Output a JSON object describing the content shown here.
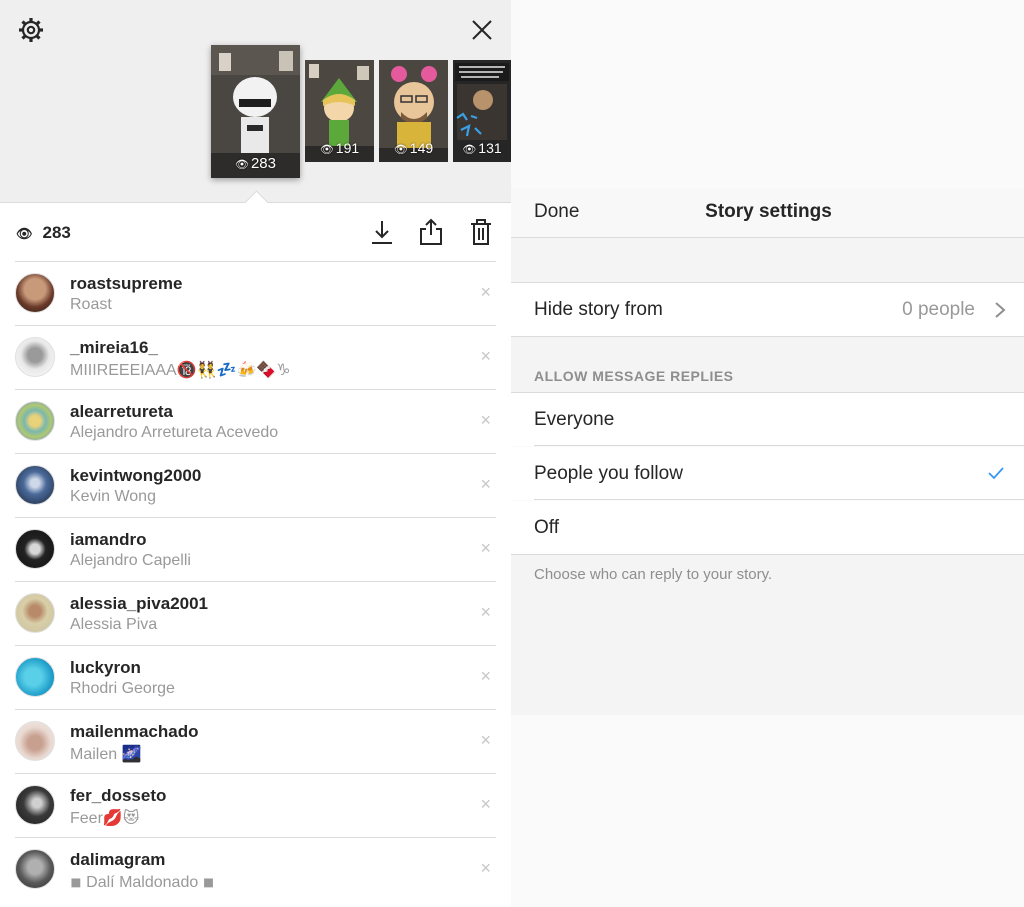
{
  "story_viewer": {
    "thumbnails": [
      {
        "views": "283",
        "selected": true
      },
      {
        "views": "191",
        "selected": false
      },
      {
        "views": "149",
        "selected": false
      },
      {
        "views": "131",
        "selected": false
      }
    ],
    "total_views": "283",
    "viewers": [
      {
        "username": "roastsupreme",
        "full_name": "Roast"
      },
      {
        "username": "_mireia16_",
        "full_name": "MIIIREEEIAAA🔞👯💤🍻🍫♑"
      },
      {
        "username": "alearretureta",
        "full_name": "Alejandro Arretureta Acevedo"
      },
      {
        "username": "kevintwong2000",
        "full_name": "Kevin Wong"
      },
      {
        "username": "iamandro",
        "full_name": "Alejandro Capelli"
      },
      {
        "username": "alessia_piva2001",
        "full_name": "Alessia Piva"
      },
      {
        "username": "luckyron",
        "full_name": "Rhodri George"
      },
      {
        "username": "mailenmachado",
        "full_name": "Mailen 🌌"
      },
      {
        "username": "fer_dosseto",
        "full_name": "Feer💋😻"
      },
      {
        "username": "dalimagram",
        "full_name": "◾ Dalí Maldonado ◾"
      }
    ],
    "remove_glyph": "×",
    "view_glyph": "👁"
  },
  "story_settings": {
    "done_label": "Done",
    "title": "Story settings",
    "hide_story_label": "Hide story from",
    "hide_story_value": "0 people",
    "section_header": "ALLOW MESSAGE REPLIES",
    "options": [
      {
        "label": "Everyone",
        "selected": false
      },
      {
        "label": "People you follow",
        "selected": true
      },
      {
        "label": "Off",
        "selected": false
      }
    ],
    "footer_note": "Choose who can reply to your story.",
    "accent_color": "#3897f0"
  }
}
